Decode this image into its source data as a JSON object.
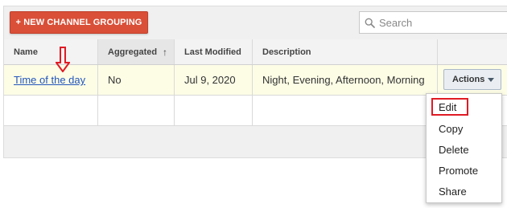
{
  "toolbar": {
    "new_button_label": "+ NEW CHANNEL GROUPING",
    "search_placeholder": "Search"
  },
  "table": {
    "columns": [
      "Name",
      "Aggregated",
      "Last Modified",
      "Description"
    ],
    "sort_indicator": "↑",
    "rows": [
      {
        "name": "Time of the day",
        "aggregated": "No",
        "last_modified": "Jul 9, 2020",
        "description": "Night, Evening, Afternoon, Morning"
      }
    ]
  },
  "actions": {
    "label": "Actions",
    "menu": [
      "Edit",
      "Copy",
      "Delete",
      "Promote",
      "Share"
    ]
  },
  "colors": {
    "accent": "#d94f38",
    "highlight_row": "#fdfde6",
    "annotation": "#e01b24",
    "link": "#2255bb"
  },
  "icons": {
    "search": "search-icon",
    "dropdown": "caret-down-icon",
    "annotation_arrow": "down-arrow-icon"
  }
}
